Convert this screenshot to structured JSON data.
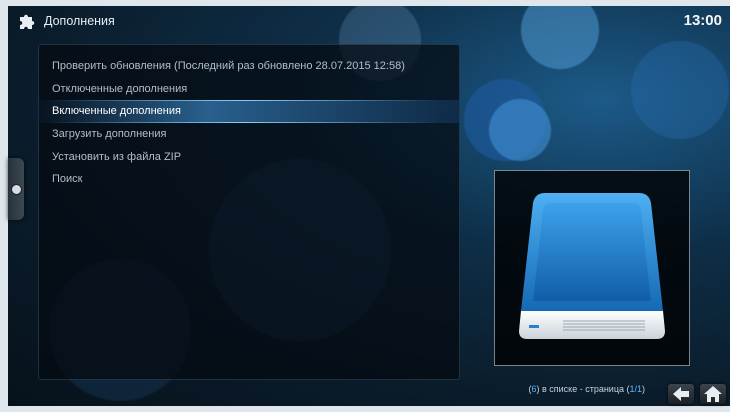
{
  "header": {
    "title": "Дополнения",
    "clock": "13:00"
  },
  "menu": {
    "items": [
      {
        "label": "Проверить обновления (Последний раз обновлено 28.07.2015 12:58)",
        "selected": false
      },
      {
        "label": "Отключенные дополнения",
        "selected": false
      },
      {
        "label": "Включенные дополнения",
        "selected": true
      },
      {
        "label": "Загрузить дополнения",
        "selected": false
      },
      {
        "label": "Установить из файла ZIP",
        "selected": false
      },
      {
        "label": "Поиск",
        "selected": false
      }
    ]
  },
  "status": {
    "count": "6",
    "in_list_text": "в списке - страница",
    "page": "1/1"
  },
  "icons": {
    "app": "puzzle-icon",
    "side_tab": "circle-icon",
    "back": "back-arrow-icon",
    "home": "home-icon",
    "preview": "hard-drive-icon"
  },
  "colors": {
    "accent": "#5bb4ff",
    "selected_highlight": "#46a0eb",
    "drive_blue": "#2a8fd8"
  }
}
